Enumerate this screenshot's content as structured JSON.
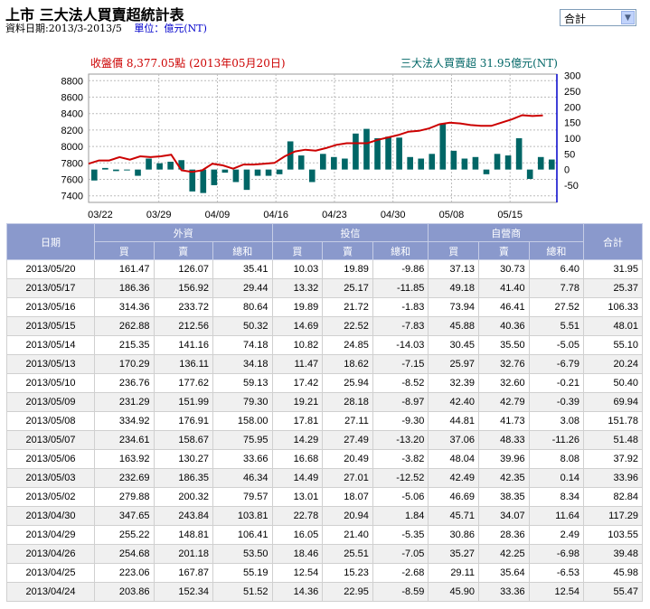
{
  "header": {
    "title": "上市 三大法人買賣超統計表",
    "date_range": "資料日期:2013/3-2013/5",
    "unit": "單位：億元(NT)"
  },
  "select": {
    "value": "合計"
  },
  "chart_data": {
    "type": "bar+line",
    "price_label": "收盤價 8,377.05點 (2013年05月20日)",
    "net_label": "三大法人買賣超 31.95億元(NT)",
    "x_labels": [
      "03/22",
      "03/29",
      "04/09",
      "04/16",
      "04/23",
      "04/30",
      "05/08",
      "05/15"
    ],
    "left_ticks": [
      7400,
      7600,
      7800,
      8000,
      8200,
      8400,
      8600,
      8800
    ],
    "right_ticks": [
      -50,
      0,
      50,
      100,
      150,
      200,
      250,
      300
    ],
    "left_range": [
      7320,
      8880
    ],
    "right_range": [
      -105,
      305
    ],
    "price": [
      7790,
      7830,
      7830,
      7870,
      7840,
      7880,
      7870,
      7880,
      7900,
      7710,
      7690,
      7710,
      7790,
      7770,
      7730,
      7780,
      7780,
      7790,
      7800,
      7880,
      7940,
      7960,
      7950,
      7980,
      8020,
      8040,
      8040,
      8040,
      8080,
      8110,
      8140,
      8180,
      8190,
      8220,
      8270,
      8290,
      8280,
      8260,
      8250,
      8250,
      8290,
      8330,
      8380,
      8370,
      8377
    ],
    "net": [
      -35,
      5,
      -5,
      -2,
      -20,
      35,
      20,
      25,
      30,
      -70,
      -75,
      -50,
      -10,
      -40,
      -65,
      -20,
      -20,
      -15,
      90,
      45,
      -40,
      50,
      40,
      35,
      115,
      130,
      100,
      105,
      102,
      40,
      35,
      50,
      145,
      60,
      35,
      40,
      -15,
      50,
      45,
      100,
      -30,
      40,
      32
    ],
    "colors": {
      "price": "#cc0000",
      "bar": "#006666",
      "right_axis": "#0000cc"
    }
  },
  "table": {
    "group_headers": {
      "date": "日期",
      "foreign": "外資",
      "trust": "投信",
      "dealer": "自營商",
      "total": "合計"
    },
    "sub_headers": [
      "買",
      "賣",
      "總和",
      "買",
      "賣",
      "總和",
      "買",
      "賣",
      "總和"
    ],
    "rows": [
      [
        "2013/05/20",
        "161.47",
        "126.07",
        "35.41",
        "10.03",
        "19.89",
        "-9.86",
        "37.13",
        "30.73",
        "6.40",
        "31.95"
      ],
      [
        "2013/05/17",
        "186.36",
        "156.92",
        "29.44",
        "13.32",
        "25.17",
        "-11.85",
        "49.18",
        "41.40",
        "7.78",
        "25.37"
      ],
      [
        "2013/05/16",
        "314.36",
        "233.72",
        "80.64",
        "19.89",
        "21.72",
        "-1.83",
        "73.94",
        "46.41",
        "27.52",
        "106.33"
      ],
      [
        "2013/05/15",
        "262.88",
        "212.56",
        "50.32",
        "14.69",
        "22.52",
        "-7.83",
        "45.88",
        "40.36",
        "5.51",
        "48.01"
      ],
      [
        "2013/05/14",
        "215.35",
        "141.16",
        "74.18",
        "10.82",
        "24.85",
        "-14.03",
        "30.45",
        "35.50",
        "-5.05",
        "55.10"
      ],
      [
        "2013/05/13",
        "170.29",
        "136.11",
        "34.18",
        "11.47",
        "18.62",
        "-7.15",
        "25.97",
        "32.76",
        "-6.79",
        "20.24"
      ],
      [
        "2013/05/10",
        "236.76",
        "177.62",
        "59.13",
        "17.42",
        "25.94",
        "-8.52",
        "32.39",
        "32.60",
        "-0.21",
        "50.40"
      ],
      [
        "2013/05/09",
        "231.29",
        "151.99",
        "79.30",
        "19.21",
        "28.18",
        "-8.97",
        "42.40",
        "42.79",
        "-0.39",
        "69.94"
      ],
      [
        "2013/05/08",
        "334.92",
        "176.91",
        "158.00",
        "17.81",
        "27.11",
        "-9.30",
        "44.81",
        "41.73",
        "3.08",
        "151.78"
      ],
      [
        "2013/05/07",
        "234.61",
        "158.67",
        "75.95",
        "14.29",
        "27.49",
        "-13.20",
        "37.06",
        "48.33",
        "-11.26",
        "51.48"
      ],
      [
        "2013/05/06",
        "163.92",
        "130.27",
        "33.66",
        "16.68",
        "20.49",
        "-3.82",
        "48.04",
        "39.96",
        "8.08",
        "37.92"
      ],
      [
        "2013/05/03",
        "232.69",
        "186.35",
        "46.34",
        "14.49",
        "27.01",
        "-12.52",
        "42.49",
        "42.35",
        "0.14",
        "33.96"
      ],
      [
        "2013/05/02",
        "279.88",
        "200.32",
        "79.57",
        "13.01",
        "18.07",
        "-5.06",
        "46.69",
        "38.35",
        "8.34",
        "82.84"
      ],
      [
        "2013/04/30",
        "347.65",
        "243.84",
        "103.81",
        "22.78",
        "20.94",
        "1.84",
        "45.71",
        "34.07",
        "11.64",
        "117.29"
      ],
      [
        "2013/04/29",
        "255.22",
        "148.81",
        "106.41",
        "16.05",
        "21.40",
        "-5.35",
        "30.86",
        "28.36",
        "2.49",
        "103.55"
      ],
      [
        "2013/04/26",
        "254.68",
        "201.18",
        "53.50",
        "18.46",
        "25.51",
        "-7.05",
        "35.27",
        "42.25",
        "-6.98",
        "39.48"
      ],
      [
        "2013/04/25",
        "223.06",
        "167.87",
        "55.19",
        "12.54",
        "15.23",
        "-2.68",
        "29.11",
        "35.64",
        "-6.53",
        "45.98"
      ],
      [
        "2013/04/24",
        "203.86",
        "152.34",
        "51.52",
        "14.36",
        "22.95",
        "-8.59",
        "45.90",
        "33.36",
        "12.54",
        "55.47"
      ]
    ]
  }
}
